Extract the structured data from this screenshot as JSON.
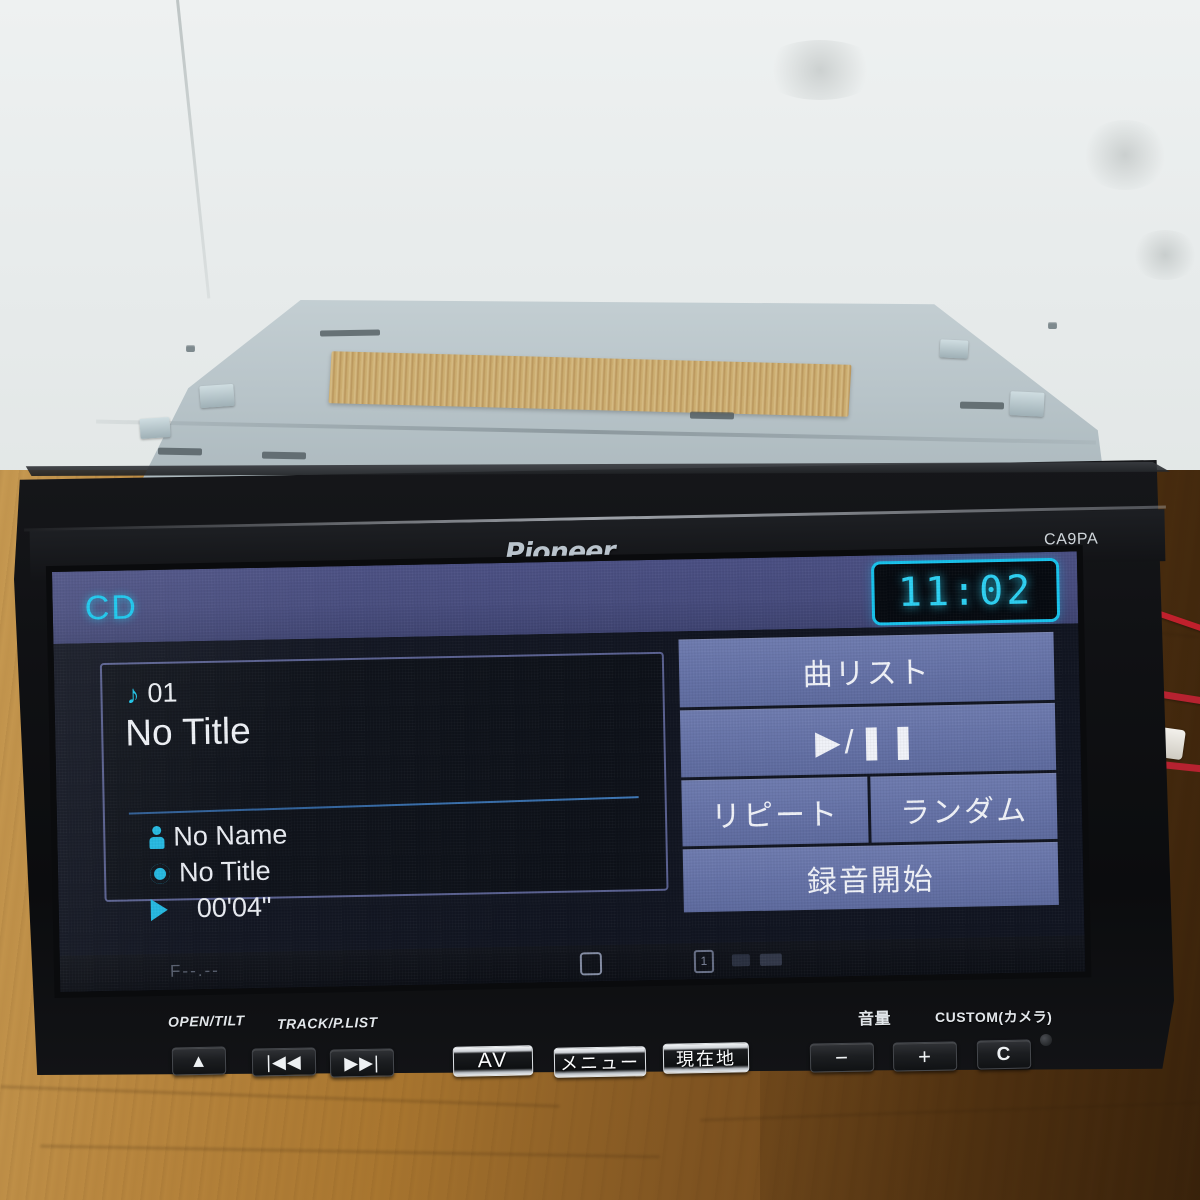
{
  "device": {
    "brand": "Pioneer",
    "model_code": "CA9PA"
  },
  "screen": {
    "source_label": "CD",
    "clock": "11:02",
    "track": {
      "note_icon": "music-note-icon",
      "track_number": "01",
      "title": "No Title",
      "artist_icon": "person-icon",
      "artist": "No Name",
      "album_icon": "disc-icon",
      "album": "No Title",
      "time_icon": "play-icon",
      "elapsed": "00'04\""
    },
    "buttons": {
      "song_list": "曲リスト",
      "play_pause": "▶/❚❚",
      "repeat": "リピート",
      "random": "ランダム",
      "record": "録音開始"
    },
    "status_bar": {
      "frequency": "F--.--",
      "mid_text": "",
      "square_icon": "rounded-square-icon",
      "one_icon": "boxed-one-icon",
      "right_text": ""
    },
    "colors": {
      "accent_cyan": "#17c8ef",
      "panel_blue": "#6673a8",
      "top_band": "#474c7e",
      "card_bg": "#0d1119"
    }
  },
  "front_panel": {
    "labels": {
      "open_tilt": "OPEN/TILT",
      "track_plist": "TRACK/P.LIST",
      "volume": "音量",
      "custom": "CUSTOM(カメラ)"
    },
    "buttons": {
      "eject": "▲",
      "prev": "|◀◀",
      "next": "▶▶|",
      "av": "AV",
      "menu": "メニュー",
      "current_location": "現在地",
      "vol_down": "−",
      "vol_up": "+",
      "custom_c": "C"
    }
  }
}
